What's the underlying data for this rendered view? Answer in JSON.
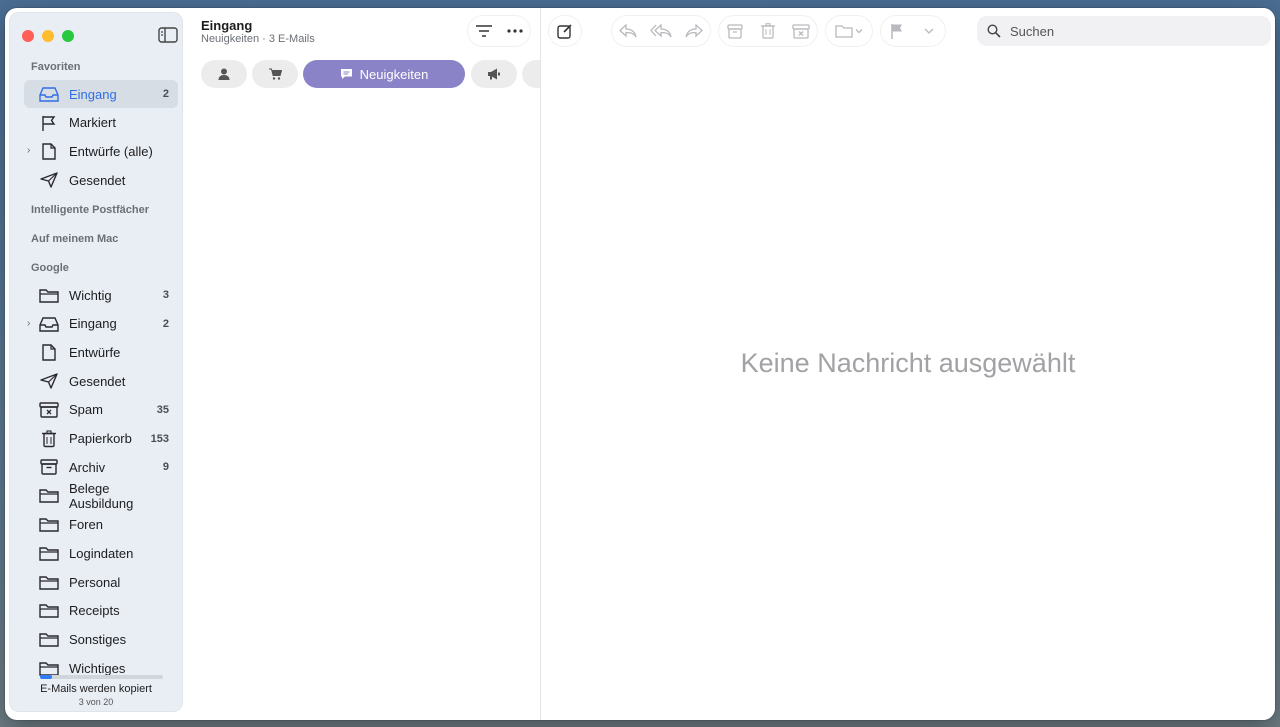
{
  "sidebar": {
    "favorites_title": "Favoriten",
    "favorites": [
      {
        "label": "Eingang",
        "count": "2",
        "icon": "inbox-icon",
        "selected": true
      },
      {
        "label": "Markiert",
        "count": "",
        "icon": "flag-icon"
      },
      {
        "label": "Entwürfe (alle)",
        "count": "",
        "icon": "document-icon",
        "expandable": true
      },
      {
        "label": "Gesendet",
        "count": "",
        "icon": "paperplane-icon"
      }
    ],
    "smart_title": "Intelligente Postfächer",
    "onmymac_title": "Auf meinem Mac",
    "google_title": "Google",
    "google": [
      {
        "label": "Wichtig",
        "count": "3",
        "icon": "folder-icon"
      },
      {
        "label": "Eingang",
        "count": "2",
        "icon": "inbox-icon",
        "expandable": true
      },
      {
        "label": "Entwürfe",
        "count": "",
        "icon": "document-icon"
      },
      {
        "label": "Gesendet",
        "count": "",
        "icon": "paperplane-icon"
      },
      {
        "label": "Spam",
        "count": "35",
        "icon": "junk-icon"
      },
      {
        "label": "Papierkorb",
        "count": "153",
        "icon": "trash-icon"
      },
      {
        "label": "Archiv",
        "count": "9",
        "icon": "archive-icon"
      },
      {
        "label": "Belege Ausbildung",
        "count": "",
        "icon": "folder-icon"
      },
      {
        "label": "Foren",
        "count": "",
        "icon": "folder-icon"
      },
      {
        "label": "Logindaten",
        "count": "",
        "icon": "folder-icon"
      },
      {
        "label": "Personal",
        "count": "",
        "icon": "folder-icon"
      },
      {
        "label": "Receipts",
        "count": "",
        "icon": "folder-icon"
      },
      {
        "label": "Sonstiges",
        "count": "",
        "icon": "folder-icon"
      },
      {
        "label": "Wichtiges",
        "count": "",
        "icon": "folder-icon"
      }
    ],
    "activity": {
      "label": "E-Mails werden kopiert",
      "count_text": "3 von 20",
      "progress": 0.1
    }
  },
  "list": {
    "title": "Eingang",
    "subtitle": "Neuigkeiten · 3 E-Mails",
    "categories": [
      {
        "name": "person-icon",
        "label": ""
      },
      {
        "name": "cart-icon",
        "label": ""
      },
      {
        "name": "chat-icon",
        "label": "Neuigkeiten",
        "active": true
      },
      {
        "name": "megaphone-icon",
        "label": ""
      }
    ]
  },
  "detail": {
    "search_placeholder": "Suchen",
    "empty_message": "Keine Nachricht ausgewählt"
  },
  "colors": {
    "accent": "#2f6fe4",
    "category_active": "#8a83c8",
    "sidebar_bg": "#e9eef4"
  }
}
